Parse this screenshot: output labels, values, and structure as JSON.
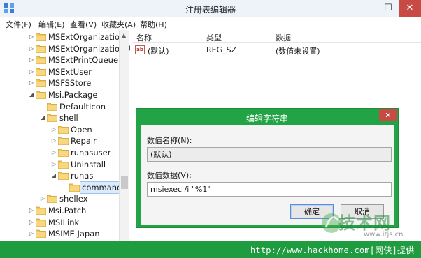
{
  "window": {
    "title": "注册表编辑器",
    "min_glyph": "—",
    "max_glyph": "☐",
    "close_glyph": "✕"
  },
  "menu": [
    "文件(F)",
    "编辑(E)",
    "查看(V)",
    "收藏夹(A)",
    "帮助(H)"
  ],
  "tree": {
    "items": [
      {
        "label": "MSExtOrganization",
        "expander": "▷",
        "level": 0
      },
      {
        "label": "MSExtOrganizationU",
        "expander": "▷",
        "level": 0
      },
      {
        "label": "MSExtPrintQueue",
        "expander": "▷",
        "level": 0
      },
      {
        "label": "MSExtUser",
        "expander": "▷",
        "level": 0
      },
      {
        "label": "MSFSStore",
        "expander": "▷",
        "level": 0
      },
      {
        "label": "Msi.Package",
        "expander": "◢",
        "level": 0
      },
      {
        "label": "DefaultIcon",
        "expander": "",
        "level": 1
      },
      {
        "label": "shell",
        "expander": "◢",
        "level": 1
      },
      {
        "label": "Open",
        "expander": "▷",
        "level": 2
      },
      {
        "label": "Repair",
        "expander": "▷",
        "level": 2
      },
      {
        "label": "runasuser",
        "expander": "▷",
        "level": 2
      },
      {
        "label": "Uninstall",
        "expander": "▷",
        "level": 2
      },
      {
        "label": "runas",
        "expander": "◢",
        "level": 2
      },
      {
        "label": "command",
        "expander": "",
        "level": 3,
        "selected": true
      },
      {
        "label": "shellex",
        "expander": "▷",
        "level": 1
      },
      {
        "label": "Msi.Patch",
        "expander": "▷",
        "level": 0
      },
      {
        "label": "MSILink",
        "expander": "▷",
        "level": 0
      },
      {
        "label": "MSIME.Japan",
        "expander": "▷",
        "level": 0
      }
    ]
  },
  "list": {
    "headers": {
      "name": "名称",
      "type": "类型",
      "data": "数据"
    },
    "rows": [
      {
        "icon": "ab",
        "name": "(默认)",
        "type": "REG_SZ",
        "data": "(数值未设置)"
      }
    ]
  },
  "dialog": {
    "title": "编辑字符串",
    "close_glyph": "✕",
    "name_label": "数值名称(N):",
    "name_value": "(默认)",
    "data_label": "数值数据(V):",
    "data_value": "msiexec /i \"%1\"",
    "ok_label": "确定",
    "cancel_label": "取消"
  },
  "footer": {
    "url": "http://www.hackhome.com[网侠]提供"
  },
  "watermark": {
    "brand": "技术网",
    "url": "www.itjs.cn"
  },
  "colors": {
    "accent_green": "#22a345",
    "close_red": "#c74a44"
  }
}
